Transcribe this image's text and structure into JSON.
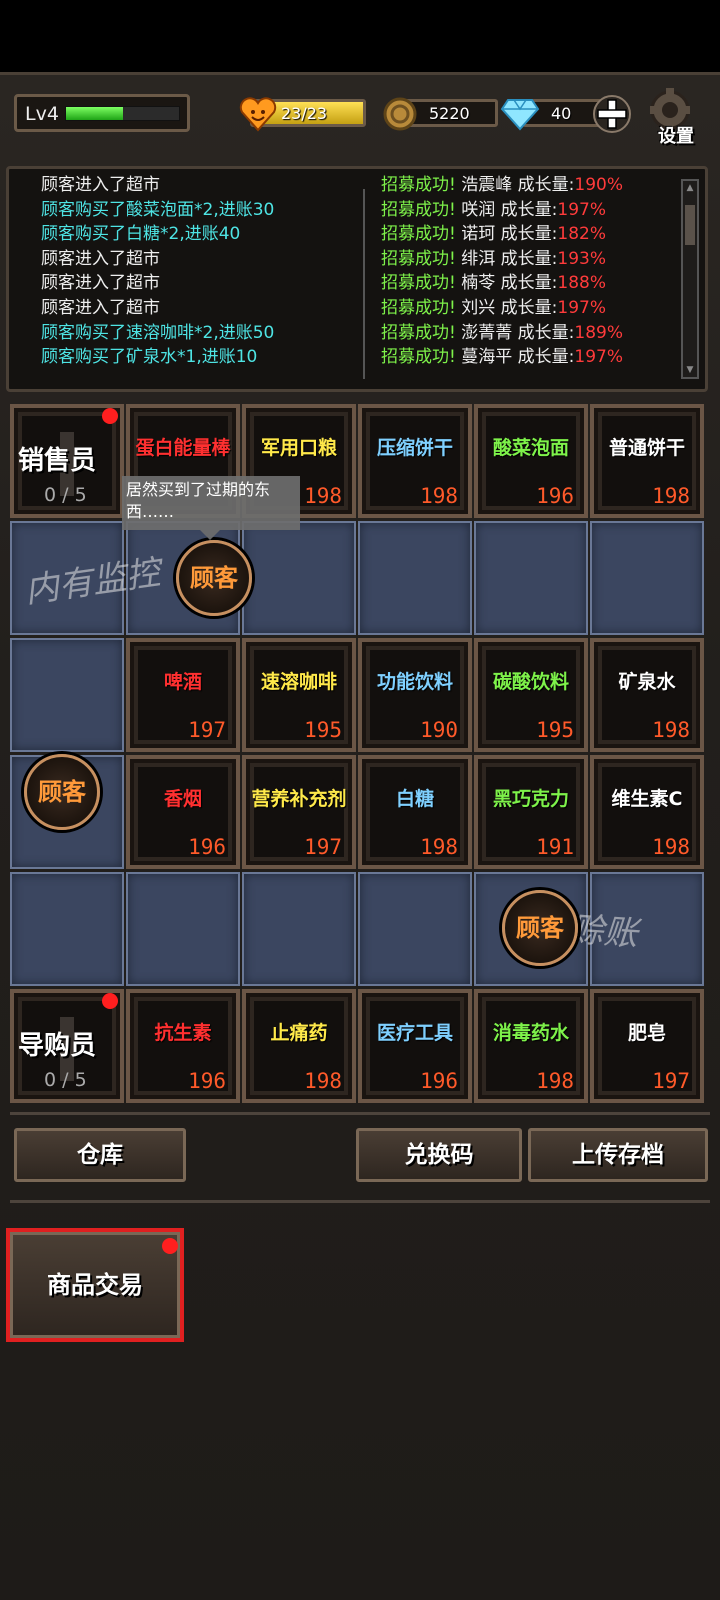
{
  "header": {
    "level": "Lv4",
    "exp_fraction": 0.5,
    "stamina": "23/23",
    "stamina_fraction": 1.0,
    "coins": "5220",
    "gems": "40",
    "settings_label": "设置"
  },
  "log": {
    "left": [
      {
        "text": "顾客进入了超市",
        "color": "white"
      },
      {
        "text": "顾客购买了酸菜泡面*2,进账30",
        "color": "cyan"
      },
      {
        "text": "顾客购买了白糖*2,进账40",
        "color": "cyan"
      },
      {
        "text": "顾客进入了超市",
        "color": "white"
      },
      {
        "text": "顾客进入了超市",
        "color": "white"
      },
      {
        "text": "顾客进入了超市",
        "color": "white"
      },
      {
        "text": "顾客购买了速溶咖啡*2,进账50",
        "color": "cyan"
      },
      {
        "text": "顾客购买了矿泉水*1,进账10",
        "color": "cyan"
      }
    ],
    "right": [
      {
        "prefix": "招募成功!",
        "name": "浩震峰",
        "label": "成长量:",
        "value": "190%"
      },
      {
        "prefix": "招募成功!",
        "name": "咲润",
        "label": "成长量:",
        "value": "197%"
      },
      {
        "prefix": "招募成功!",
        "name": "诺珂",
        "label": "成长量:",
        "value": "182%"
      },
      {
        "prefix": "招募成功!",
        "name": "绯洱",
        "label": "成长量:",
        "value": "193%"
      },
      {
        "prefix": "招募成功!",
        "name": "楠苓",
        "label": "成长量:",
        "value": "188%"
      },
      {
        "prefix": "招募成功!",
        "name": "刘兴",
        "label": "成长量:",
        "value": "197%"
      },
      {
        "prefix": "招募成功!",
        "name": "澎菁菁",
        "label": "成长量:",
        "value": "189%"
      },
      {
        "prefix": "招募成功!",
        "name": "蔓海平",
        "label": "成长量:",
        "value": "197%"
      }
    ]
  },
  "staff": {
    "sales": {
      "title": "销售员",
      "count": "0 / 5"
    },
    "guide": {
      "title": "导购员",
      "count": "0 / 5"
    }
  },
  "shelves": {
    "row1": [
      {
        "name": "蛋白能量棒",
        "stock": "",
        "color": "#ff3030"
      },
      {
        "name": "军用口粮",
        "stock": "198",
        "color": "#ffe94a"
      },
      {
        "name": "压缩饼干",
        "stock": "198",
        "color": "#7fd0ff"
      },
      {
        "name": "酸菜泡面",
        "stock": "196",
        "color": "#7ef24a"
      },
      {
        "name": "普通饼干",
        "stock": "198",
        "color": "#ffffff"
      }
    ],
    "row2": [
      {
        "name": "啤酒",
        "stock": "197",
        "color": "#ff3030"
      },
      {
        "name": "速溶咖啡",
        "stock": "195",
        "color": "#ffe94a"
      },
      {
        "name": "功能饮料",
        "stock": "190",
        "color": "#7fd0ff"
      },
      {
        "name": "碳酸饮料",
        "stock": "195",
        "color": "#7ef24a"
      },
      {
        "name": "矿泉水",
        "stock": "198",
        "color": "#ffffff"
      }
    ],
    "row3": [
      {
        "name": "香烟",
        "stock": "196",
        "color": "#ff3030"
      },
      {
        "name": "营养补充剂",
        "stock": "197",
        "color": "#ffe94a"
      },
      {
        "name": "白糖",
        "stock": "198",
        "color": "#7fd0ff"
      },
      {
        "name": "黑巧克力",
        "stock": "191",
        "color": "#7ef24a"
      },
      {
        "name": "维生素C",
        "stock": "198",
        "color": "#ffffff"
      }
    ],
    "row4": [
      {
        "name": "抗生素",
        "stock": "196",
        "color": "#ff3030"
      },
      {
        "name": "止痛药",
        "stock": "198",
        "color": "#ffe94a"
      },
      {
        "name": "医疗工具",
        "stock": "196",
        "color": "#7fd0ff"
      },
      {
        "name": "消毒药水",
        "stock": "198",
        "color": "#7ef24a"
      },
      {
        "name": "肥皂",
        "stock": "197",
        "color": "#ffffff"
      }
    ]
  },
  "customers": {
    "label": "顾客"
  },
  "graffiti": {
    "text1": "内有监控",
    "text2": "赊账"
  },
  "bubble": {
    "text": "居然买到了过期的东西……"
  },
  "buttons": {
    "warehouse": "仓库",
    "redeem": "兑换码",
    "upload": "上传存档",
    "trade": "商品交易"
  }
}
